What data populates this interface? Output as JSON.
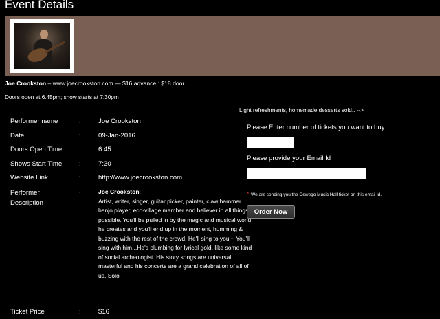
{
  "page": {
    "title": "Event Details"
  },
  "banner": {
    "photo_alt": "Joe Crookston performing with guitar"
  },
  "headline": {
    "performer": "Joe Crookston",
    "rest": " – www.joecrookston.com —  $16 advance  :  $18 door"
  },
  "doors_line": "Doors open at 6.45pm; show starts at 7:30pm",
  "refresh_line": "Light refreshments, homemade desserts sold.. -->",
  "details": {
    "colon": ":",
    "performer_name": {
      "label": "Performer name",
      "value": "Joe Crookston"
    },
    "date": {
      "label": "Date",
      "value": "09-Jan-2016"
    },
    "doors_open": {
      "label": "Doors Open Time",
      "value": "6:45"
    },
    "show_start": {
      "label": "Shows Start Time",
      "value": "7:30"
    },
    "website": {
      "label": "Website Link",
      "value": "http://www.joecrookston.com"
    },
    "description": {
      "label_line1": "Performer",
      "label_line2": "Description",
      "heading": "Joe Crookston",
      "heading_suffix": ":",
      "body": "Artist, writer, singer, guitar picker, painter, claw hammer banjo player, eco-village member and believer in all things possible.  You'll be pulled in by the magic and musical world he creates and you'll end up in the moment, humming & buzzing with the rest of the crowd.  He'll sing to you ~ You'll sing with him...He's plumbing for lyrical gold, like some kind of social archeologist.  His story songs are universal, masterful and his concerts are a grand celebration of all of us. Solo"
    },
    "ticket_price": {
      "label": "Ticket Price",
      "value": "$16"
    }
  },
  "form": {
    "tickets_label": "Please Enter number of tickets you want to buy",
    "tickets_value": "",
    "email_label": "Please provide your Email Id",
    "email_value": "",
    "notice_star": "*",
    "notice_text": "We are sending you the Oswego Music Hall ticket on this email id.",
    "order_button": "Order Now"
  },
  "colors": {
    "background": "#000000",
    "banner": "#7a5f55",
    "notice_star": "#e03030"
  }
}
